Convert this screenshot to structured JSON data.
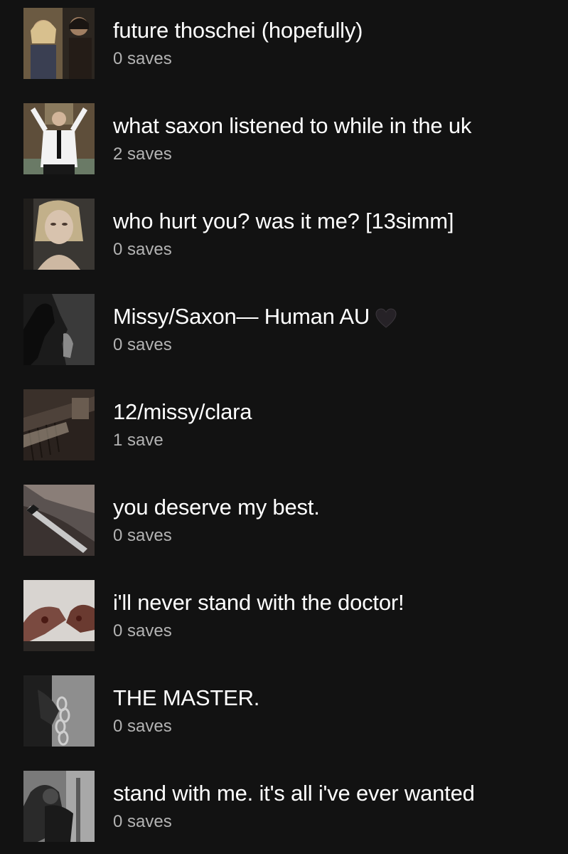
{
  "playlists": [
    {
      "title": "future thoschei (hopefully)",
      "saves": "0 saves",
      "thumb": "two-people-scene-thumbnail"
    },
    {
      "title": "what saxon listened to while in the uk",
      "saves": "2 saves",
      "thumb": "man-in-suit-arms-raised-thumbnail"
    },
    {
      "title": "who hurt you? was it me? [13simm]",
      "saves": "0 saves",
      "thumb": "blonde-woman-portrait-thumbnail"
    },
    {
      "title": "Missy/Saxon— Human AU",
      "saves": "0 saves",
      "thumb": "dark-silhouette-thumbnail",
      "emoji": "black-heart-icon"
    },
    {
      "title": "12/missy/clara",
      "saves": "1 save",
      "thumb": "piano-keys-thumbnail"
    },
    {
      "title": "you deserve my best.",
      "saves": "0 saves",
      "thumb": "hand-with-knife-thumbnail"
    },
    {
      "title": "i'll never stand with the doctor!",
      "saves": "0 saves",
      "thumb": "bloody-hands-thumbnail"
    },
    {
      "title": "THE MASTER.",
      "saves": "0 saves",
      "thumb": "chained-hands-thumbnail"
    },
    {
      "title": "stand with me. it's all i've ever wanted",
      "saves": "0 saves",
      "thumb": "embracing-couple-thumbnail"
    }
  ],
  "colors": {
    "background": "#121212",
    "title": "#ffffff",
    "subtitle": "#b3b3b3"
  }
}
